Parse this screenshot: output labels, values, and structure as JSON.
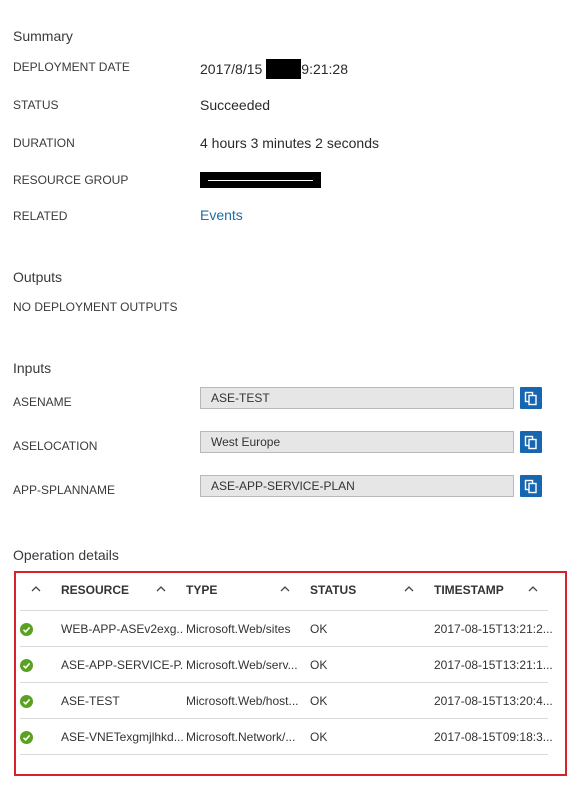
{
  "summary": {
    "title": "Summary",
    "deployment_date_label": "DEPLOYMENT DATE",
    "deployment_date_prefix": "2017/8/15",
    "deployment_date_suffix": "9:21:28",
    "status_label": "STATUS",
    "status_value": "Succeeded",
    "duration_label": "DURATION",
    "duration_value": "4 hours 3 minutes 2 seconds",
    "resource_group_label": "RESOURCE GROUP",
    "related_label": "RELATED",
    "related_link": "Events"
  },
  "outputs": {
    "title": "Outputs",
    "empty_text": "NO DEPLOYMENT OUTPUTS"
  },
  "inputs": {
    "title": "Inputs",
    "fields": [
      {
        "label": "ASENAME",
        "value": "ASE-TEST"
      },
      {
        "label": "ASELOCATION",
        "value": "West Europe"
      },
      {
        "label": "APP-SPLANNAME",
        "value": "ASE-APP-SERVICE-PLAN"
      }
    ]
  },
  "operations": {
    "title": "Operation details",
    "headers": {
      "resource": "RESOURCE",
      "type": "TYPE",
      "status": "STATUS",
      "timestamp": "TIMESTAMP"
    },
    "rows": [
      {
        "resource": "WEB-APP-ASEv2exg...",
        "type": "Microsoft.Web/sites",
        "status": "OK",
        "timestamp": "2017-08-15T13:21:2..."
      },
      {
        "resource": "ASE-APP-SERVICE-P...",
        "type": "Microsoft.Web/serv...",
        "status": "OK",
        "timestamp": "2017-08-15T13:21:1..."
      },
      {
        "resource": "ASE-TEST",
        "type": "Microsoft.Web/host...",
        "status": "OK",
        "timestamp": "2017-08-15T13:20:4..."
      },
      {
        "resource": "ASE-VNETexgmjlhkd...",
        "type": "Microsoft.Network/...",
        "status": "OK",
        "timestamp": "2017-08-15T09:18:3..."
      }
    ]
  },
  "colors": {
    "link": "#1d6fa5",
    "highlight_border": "#d6222a",
    "copy_button": "#1767b0",
    "ok_status": "#5ba121"
  }
}
